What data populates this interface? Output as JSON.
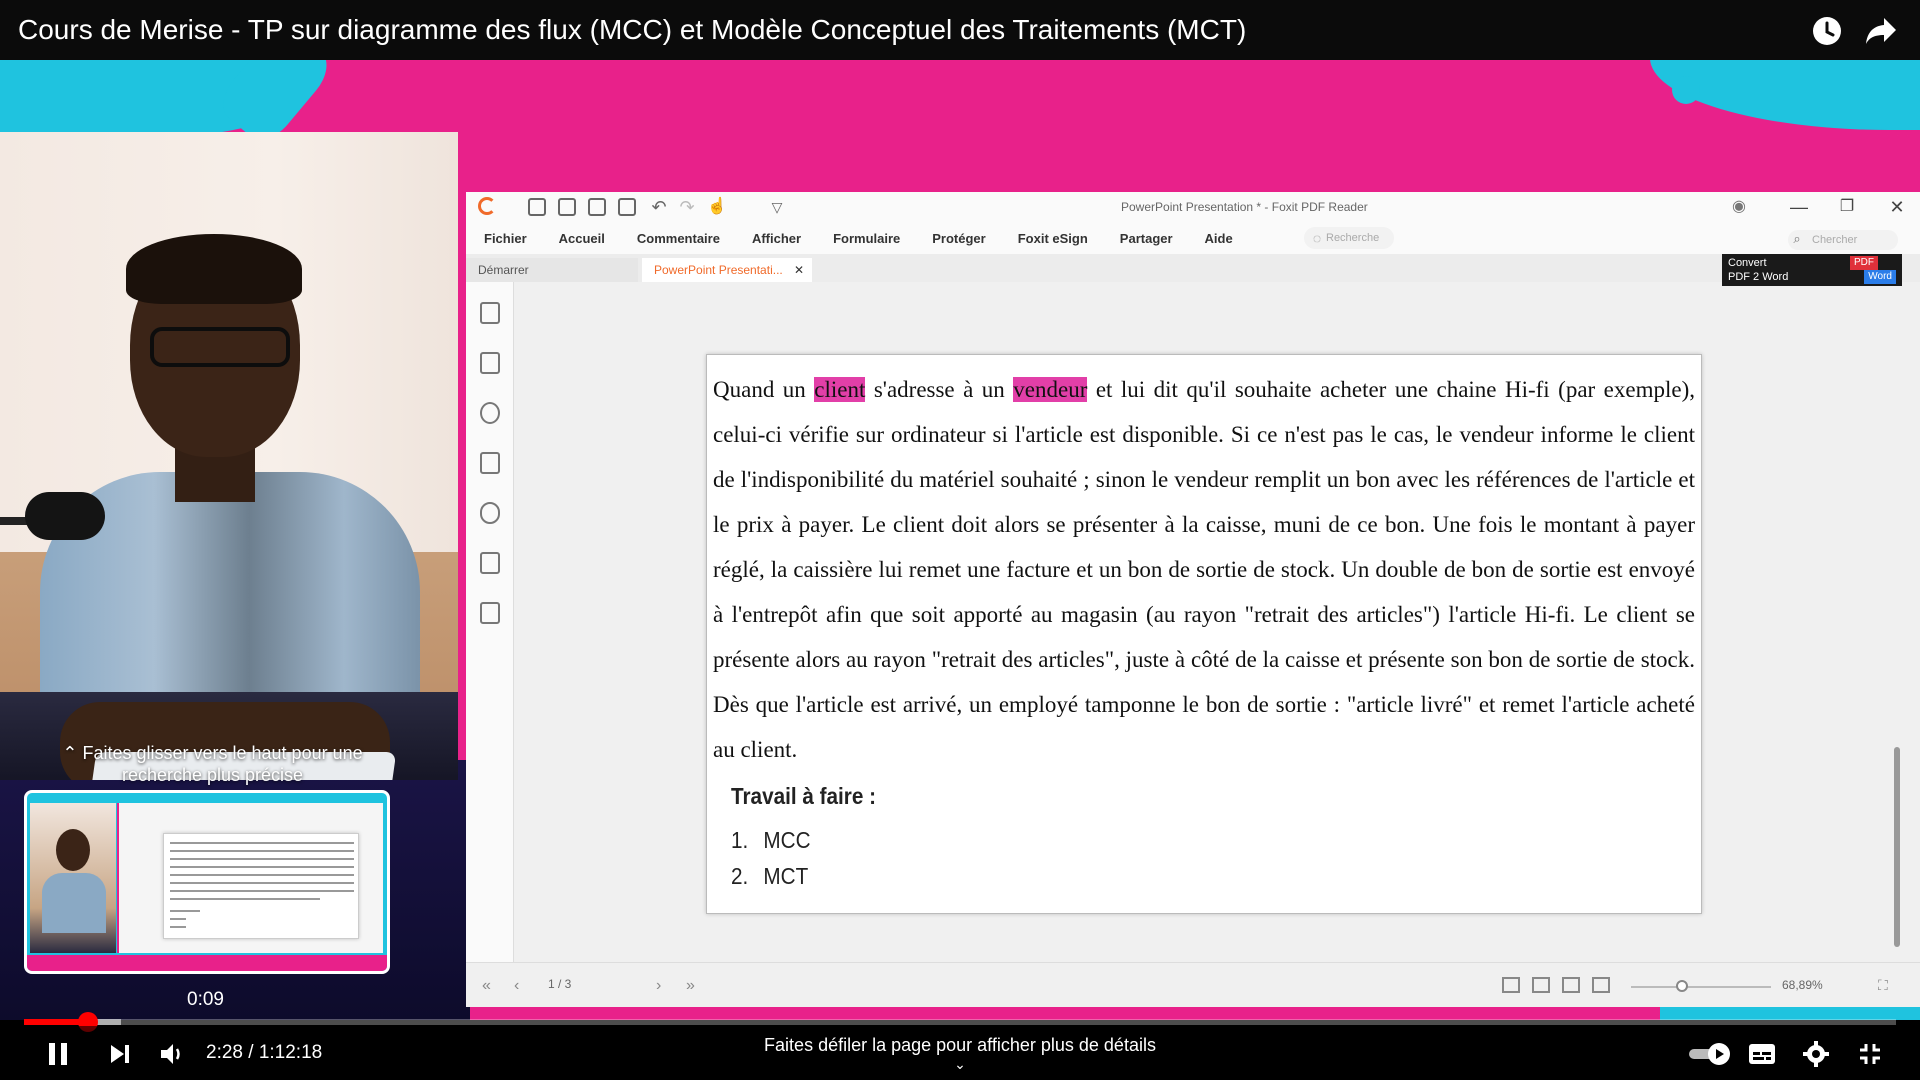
{
  "video": {
    "title": "Cours de Merise - TP sur diagramme des flux (MCC) et Modèle Conceptuel des Traitements (MCT)",
    "current_time": "2:28",
    "duration": "1:12:18",
    "time_display": "2:28 / 1:12:18",
    "played_fraction": 0.034,
    "buffered_fraction": 0.052,
    "preview_time": "0:09",
    "swipe_hint": "Faites glisser vers le haut pour une recherche plus précise",
    "scroll_hint": "Faites défiler la page pour afficher plus de détails",
    "accent_color": "#ff0000",
    "background_color": "#e8218a"
  },
  "pdf_app": {
    "window_title": "PowerPoint Presentation * - Foxit PDF Reader",
    "menu": [
      "Fichier",
      "Accueil",
      "Commentaire",
      "Afficher",
      "Formulaire",
      "Protéger",
      "Foxit eSign",
      "Partager",
      "Aide"
    ],
    "search_placeholder": "Recherche",
    "search2_placeholder": "Chercher",
    "tabs": {
      "home": "Démarrer",
      "document": "PowerPoint Presentati..."
    },
    "convert_banner": {
      "line1": "Convert",
      "line2": "PDF 2 Word",
      "pdf_badge": "PDF",
      "word_badge": "Word"
    },
    "page_indicator": "1 / 3",
    "zoom_level": "68,89%",
    "highlight_color": "#e23fa8"
  },
  "document": {
    "para_before_client": "Quand un ",
    "highlight_1": "client",
    "para_between": " s'adresse à un ",
    "highlight_2": "vendeur",
    "para_after": " et lui dit qu'il souhaite acheter une chaine Hi-fi (par exemple), celui-ci vérifie sur ordinateur si l'article est disponible. Si ce n'est pas le cas, le vendeur informe le client de l'indisponibilité du matériel souhaité ; sinon le vendeur remplit un bon avec les références de l'article et le prix à payer. Le client doit alors se présenter à la caisse, muni de ce bon. Une fois le montant à payer réglé, la caissière lui remet une facture et un bon de sortie de stock. Un double de bon de sortie est envoyé à l'entrepôt afin que soit apporté au magasin (au rayon \"retrait des articles\") l'article Hi-fi. Le client se présente alors au rayon \"retrait des articles\", juste à côté de la caisse et présente son bon de sortie de stock. Dès que l'article est arrivé, un employé tamponne le bon de sortie : \"article livré\" et remet l'article acheté au client.",
    "work_title": "Travail à faire :",
    "work_items": [
      {
        "num": "1.",
        "label": "MCC"
      },
      {
        "num": "2.",
        "label": "MCT"
      }
    ]
  }
}
